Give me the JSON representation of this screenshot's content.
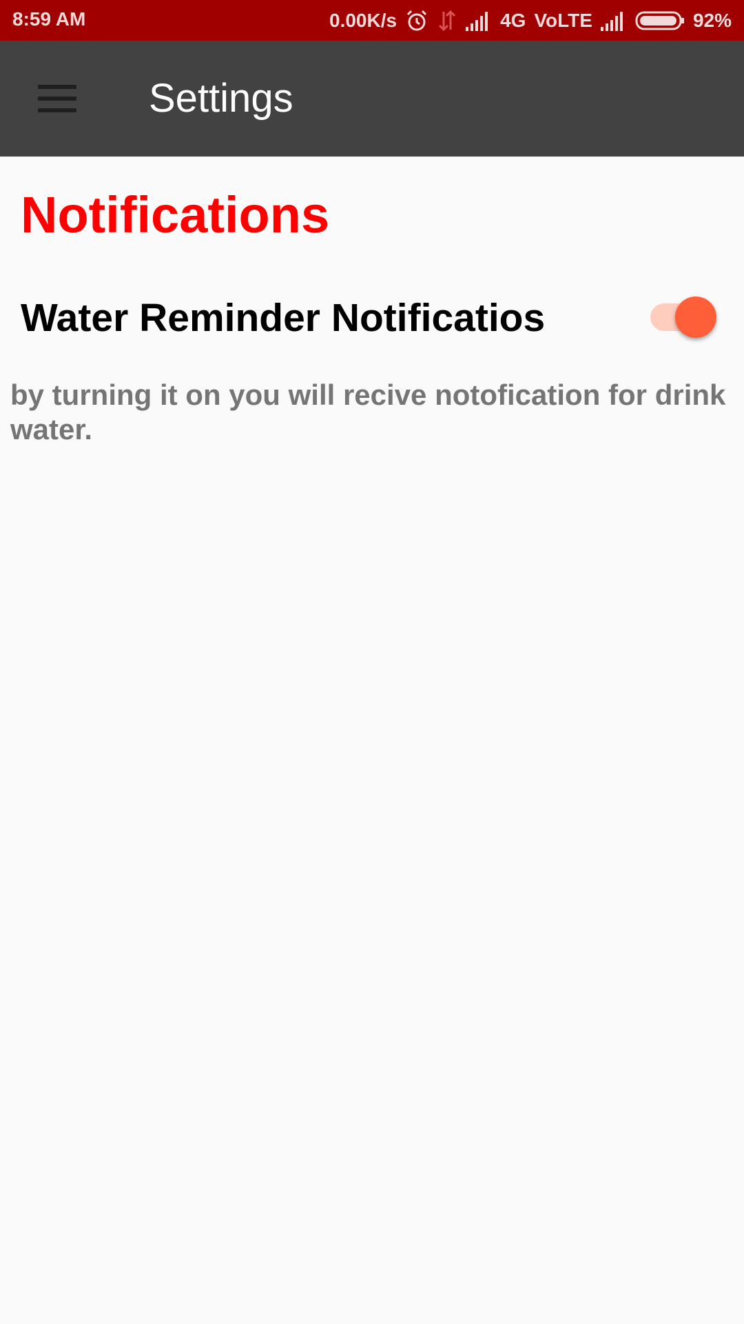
{
  "status_bar": {
    "time": "8:59 AM",
    "net_speed": "0.00K/s",
    "network_type": "4G",
    "volte": "VoLTE",
    "battery_percent": "92%",
    "battery_level": 0.92,
    "icons": [
      "alarm-icon",
      "data-arrows-icon",
      "signal-icon",
      "signal-icon",
      "battery-icon"
    ],
    "background_color": "#a10000"
  },
  "toolbar": {
    "title": "Settings",
    "menu_icon": "hamburger-menu-icon",
    "background_color": "#424242"
  },
  "settings": {
    "section_title": "Notifications",
    "section_title_color": "#ff0000",
    "items": [
      {
        "title": "Water Reminder Notificatios",
        "summary": "by turning it on you will recive notofication for drink water.",
        "toggle_on": true,
        "accent_color": "#ff5f38"
      }
    ]
  }
}
